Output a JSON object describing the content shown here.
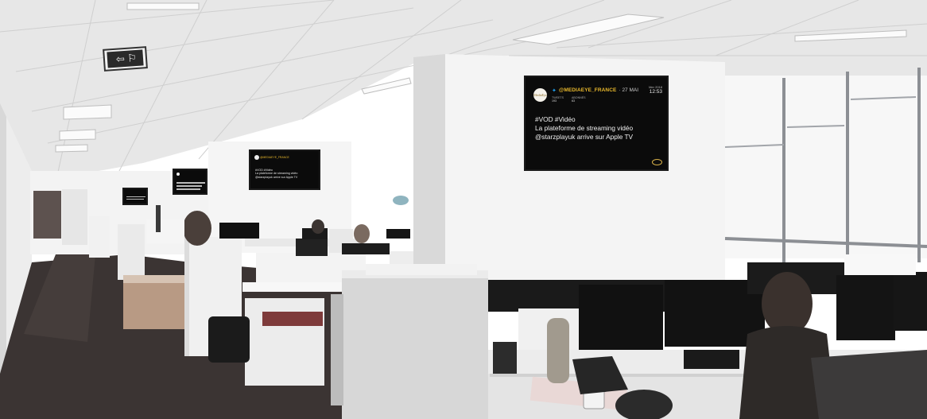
{
  "scene": {
    "kind": "open-plan office with wall-mounted screens showing a tweet",
    "palette": {
      "screen_bg": "#0b0b0b",
      "handle_color": "#e8b82c",
      "bird_color": "#1da1f2",
      "carpet": "#3a3534",
      "ceiling": "#e9e9e9"
    }
  },
  "exit_sign": {
    "icon": "exit-running-man-icon"
  },
  "main_screen": {
    "handle": "@MEDIAEYE_FRANCE",
    "date": "· 27 MAI",
    "stat1_label": "TWEETS",
    "stat1_value": "193",
    "stat2_label": "ABONNÉS",
    "stat2_value": "63",
    "time_label": "Mer 2018",
    "time_value": "12:53",
    "line1": "#VOD #Vidéo",
    "line2": "La plateforme de streaming vidéo",
    "line3": "@starzplayuk arrive sur Apple TV",
    "avatar_text": "MediaEye"
  },
  "mid_screen": {
    "handle": "@MEDIAEYE_FRANCE",
    "line1": "#VOD #Vidéo",
    "line2": "La plateforme de streaming vidéo",
    "line3": "@starzplayuk arrive sur Apple TV"
  }
}
